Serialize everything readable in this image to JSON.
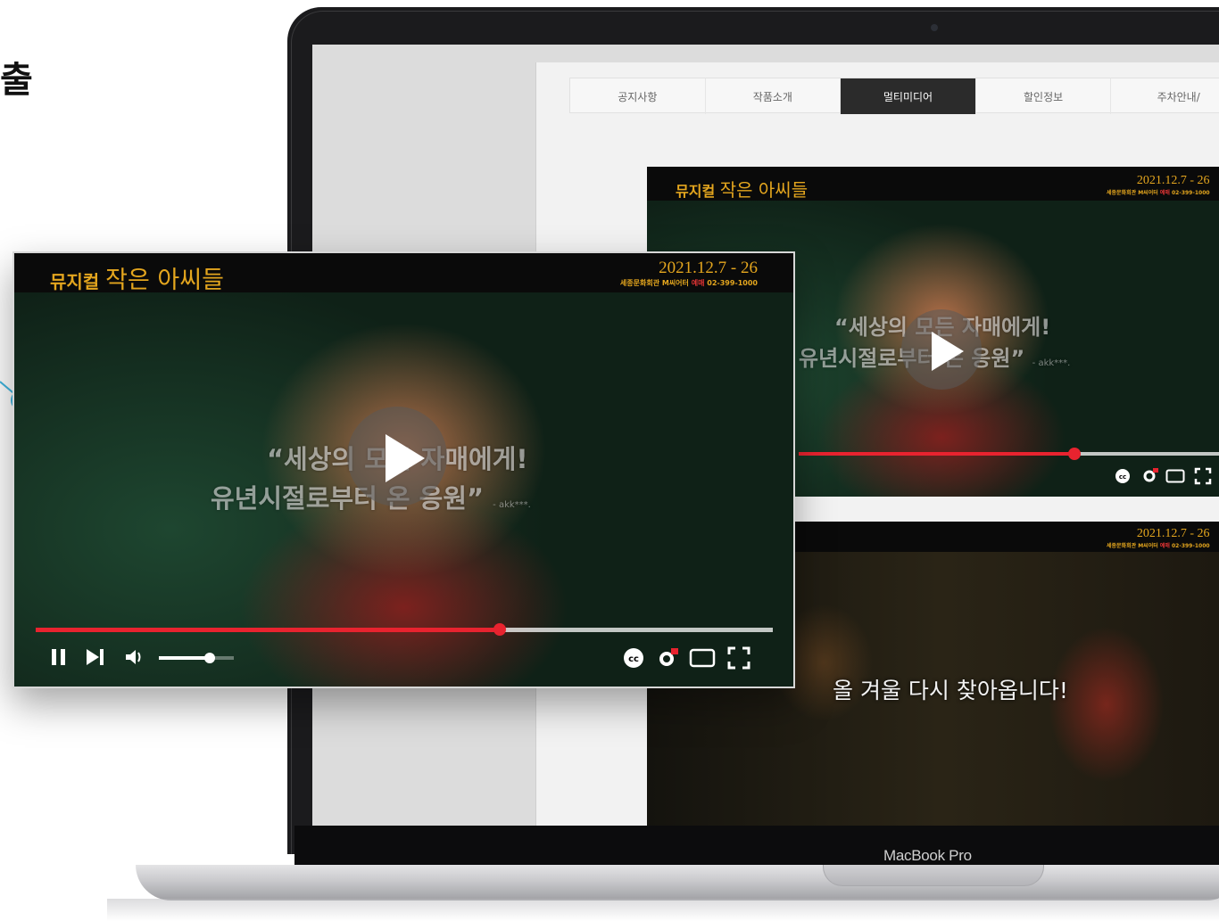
{
  "headline": "출",
  "laptop": {
    "model_label": "MacBook Pro"
  },
  "tabs": [
    {
      "label": "공지사항",
      "active": false
    },
    {
      "label": "작품소개",
      "active": false
    },
    {
      "label": "멀티미디어",
      "active": true
    },
    {
      "label": "할인정보",
      "active": false
    },
    {
      "label": "주차안내/"
    }
  ],
  "video": {
    "brand_prefix": "뮤지컬",
    "brand_title": "작은 아씨들",
    "dates": "2021.12.7 - 26",
    "venue": "세종문화회관 M씨어터",
    "booking_label": "예매",
    "phone": "02-399-1000",
    "quote_line1": "“세상의 모든 자매에게!",
    "quote_line2": "유년시절로부터 온 응원”",
    "quote_author": "- akk***.",
    "subtitle": "올 겨울 다시 찾아옵니다!",
    "progress": 0.63,
    "volume": 0.68
  },
  "icons": {
    "pause": "pause-icon",
    "next": "skip-next-icon",
    "volume": "volume-icon",
    "cc": "closed-captions-icon",
    "settings": "settings-gear-icon",
    "theater": "theater-mode-icon",
    "fullscreen": "fullscreen-icon"
  },
  "colors": {
    "accent_gold": "#e4a61e",
    "progress_red": "#e8232f",
    "connector_blue": "#3fb6e0"
  }
}
